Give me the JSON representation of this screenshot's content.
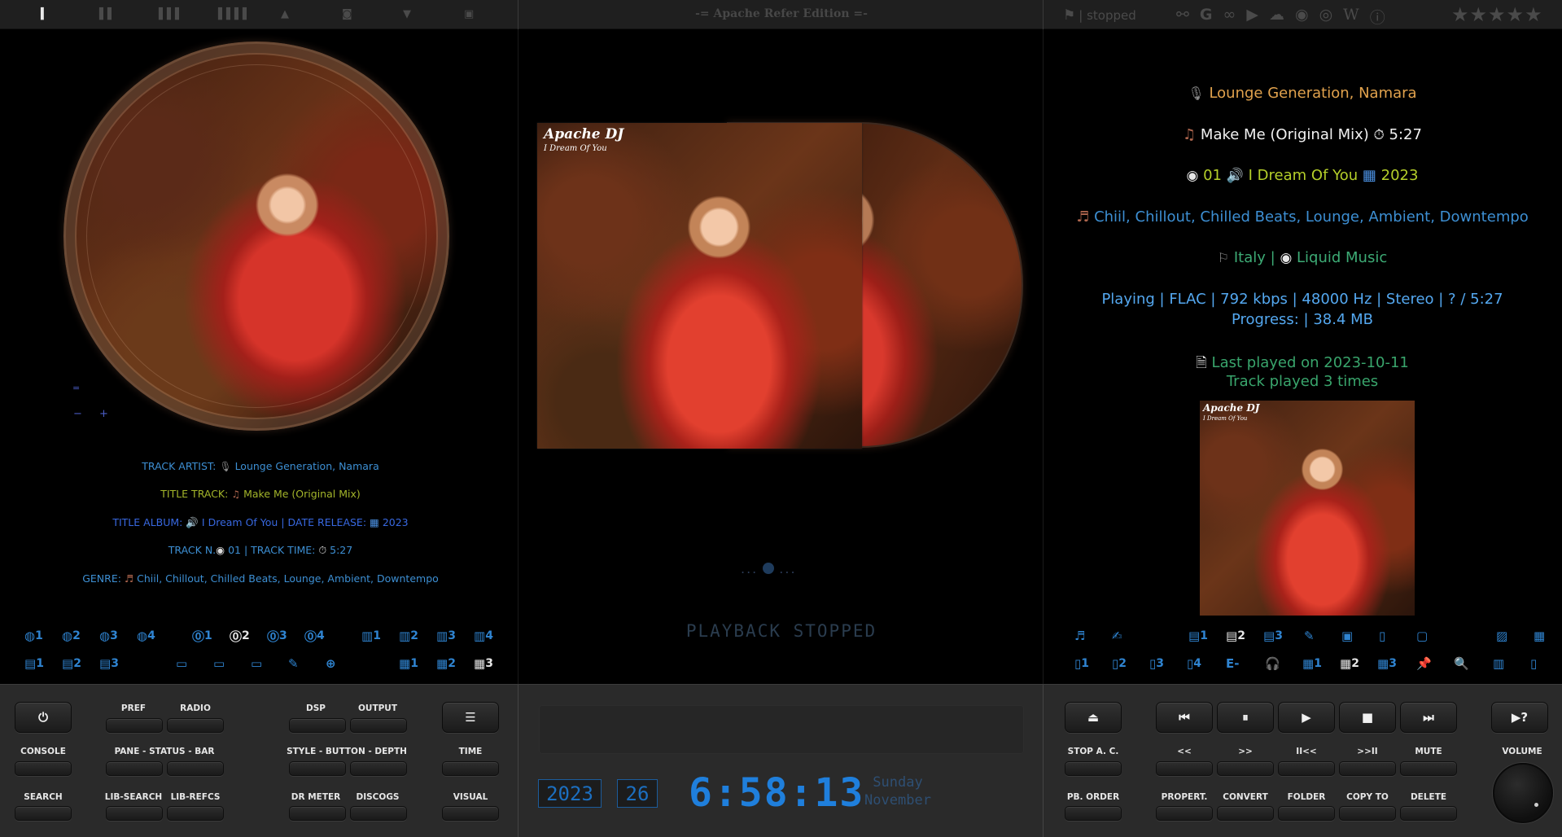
{
  "toolbar": {
    "edition": "-= Apache Refer Edition =-",
    "status": "stopped",
    "stars": "★★★★★"
  },
  "left_info": {
    "artist_label": "TRACK ARTIST:",
    "artist": "Lounge Generation, Namara",
    "title_label": "TITLE TRACK:",
    "title": "Make Me (Original Mix)",
    "album_label": "TITLE ALBUM:",
    "album": "I Dream Of You",
    "release_label": "| DATE RELEASE:",
    "year": "2023",
    "trackno_label": "TRACK N.",
    "trackno": "01",
    "tracktime_label": "| TRACK TIME:",
    "tracktime": "5:27",
    "genre_label": "GENRE:",
    "genre": "Chiil, Chillout, Chilled Beats, Lounge, Ambient, Downtempo"
  },
  "left_minus": "−",
  "left_plus": "+",
  "left_row1": [
    {
      "icon": "◍",
      "n": "1"
    },
    {
      "icon": "◍",
      "n": "2"
    },
    {
      "icon": "◍",
      "n": "3"
    },
    {
      "icon": "◍",
      "n": "4"
    },
    {
      "icon": "⓪",
      "n": "1"
    },
    {
      "icon": "⓪",
      "n": "2"
    },
    {
      "icon": "⓪",
      "n": "3"
    },
    {
      "icon": "⓪",
      "n": "4"
    },
    {
      "icon": "▥",
      "n": "1"
    },
    {
      "icon": "▥",
      "n": "2"
    },
    {
      "icon": "▥",
      "n": "3"
    },
    {
      "icon": "▥",
      "n": "4"
    }
  ],
  "left_row2": [
    {
      "icon": "▤",
      "n": "1"
    },
    {
      "icon": "▤",
      "n": "2"
    },
    {
      "icon": "▤",
      "n": "3"
    },
    {
      "icon": "▭",
      "n": ""
    },
    {
      "icon": "▭",
      "n": ""
    },
    {
      "icon": "▭",
      "n": ""
    },
    {
      "icon": "✎",
      "n": ""
    },
    {
      "icon": "⊕",
      "n": ""
    },
    {
      "icon": "▦",
      "n": "1"
    },
    {
      "icon": "▦",
      "n": "2"
    },
    {
      "icon": "▦",
      "n": "3"
    }
  ],
  "center": {
    "cover_title": "Apache DJ",
    "cover_subtitle": "I Dream Of You",
    "pager_left": "...",
    "pager_right": "...",
    "playback_status": "PLAYBACK STOPPED"
  },
  "right_info": {
    "artist": "Lounge Generation, Namara",
    "title": "Make Me (Original Mix)",
    "duration": "5:27",
    "trackno": "01",
    "album": "I Dream Of You",
    "year": "2023",
    "genre": "Chiil, Chillout, Chilled Beats, Lounge, Ambient, Downtempo",
    "country": "Italy",
    "country_sep": "|",
    "label": "Liquid Music",
    "tech": "Playing | FLAC | 792 kbps | 48000 Hz | Stereo | ? / 5:27",
    "progress": "Progress:   | 38.4 MB",
    "last_played": "Last played on 2023-10-11",
    "play_count": "Track played 3 times"
  },
  "right_row1": [
    {
      "icon": "♬",
      "n": ""
    },
    {
      "icon": "✍",
      "n": ""
    },
    {
      "icon": "▤",
      "n": "1"
    },
    {
      "icon": "▤",
      "n": "2"
    },
    {
      "icon": "▤",
      "n": "3"
    },
    {
      "icon": "✎",
      "n": ""
    },
    {
      "icon": "▣",
      "n": ""
    },
    {
      "icon": "▯",
      "n": ""
    },
    {
      "icon": "▢",
      "n": ""
    },
    {
      "icon": "▨",
      "n": ""
    },
    {
      "icon": "▦",
      "n": ""
    }
  ],
  "right_row2": [
    {
      "icon": "▯",
      "n": "1"
    },
    {
      "icon": "▯",
      "n": "2"
    },
    {
      "icon": "▯",
      "n": "3"
    },
    {
      "icon": "▯",
      "n": "4"
    },
    {
      "icon": "E-",
      "n": ""
    },
    {
      "icon": "🎧",
      "n": ""
    },
    {
      "icon": "▦",
      "n": "1"
    },
    {
      "icon": "▦",
      "n": "2"
    },
    {
      "icon": "▦",
      "n": "3"
    },
    {
      "icon": "📌",
      "n": ""
    },
    {
      "icon": "🔍",
      "n": ""
    },
    {
      "icon": "▥",
      "n": ""
    },
    {
      "icon": "▯",
      "n": ""
    }
  ],
  "bottom": {
    "pref": "PREF",
    "radio": "RADIO",
    "dsp": "DSP",
    "output": "OUTPUT",
    "console": "CONSOLE",
    "pane_status_bar": "PANE - STATUS - BAR",
    "style_button_depth": "STYLE - BUTTON - DEPTH",
    "time": "TIME",
    "search": "SEARCH",
    "lib_search": "LIB-SEARCH",
    "lib_refcs": "LIB-REFCS",
    "dr_meter": "DR METER",
    "discogs": "DISCOGS",
    "visual": "VISUAL",
    "stop_ac": "STOP A. C.",
    "pb_order": "PB. ORDER",
    "prev": "<<",
    "next": ">>",
    "prev_album": "II<<",
    "next_album": ">>II",
    "mute": "MUTE",
    "properties": "PROPERT.",
    "convert": "CONVERT",
    "folder": "FOLDER",
    "copy_to": "COPY TO",
    "delete": "DELETE",
    "volume": "VOLUME",
    "help": "▶?"
  },
  "clock": {
    "year": "2023",
    "day": "26",
    "time": "6:58:13",
    "weekday": "Sunday",
    "month": "November"
  }
}
